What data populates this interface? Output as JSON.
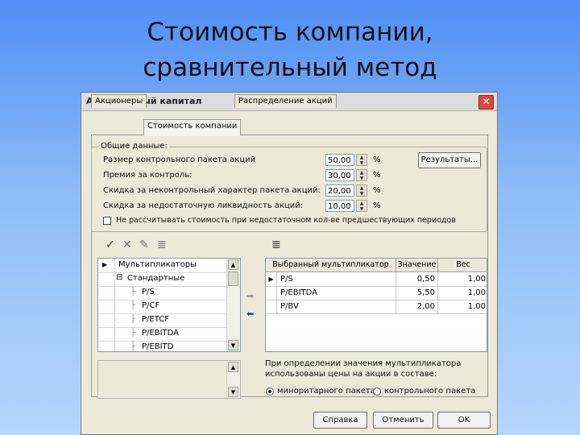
{
  "slide": {
    "title_line1": "Стоимость компании,",
    "title_line2": "сравнительный метод"
  },
  "window": {
    "title": "Акционерный капитал",
    "close_glyph": "✕"
  },
  "tabs": [
    {
      "label": "Акционеры"
    },
    {
      "label": "Стоимость компании"
    },
    {
      "label": "Распределение акций"
    }
  ],
  "general": {
    "group_label": "Общие данные:",
    "rows": [
      {
        "label": "Размер контрольного пакета акций",
        "value": "50,00",
        "unit": "%"
      },
      {
        "label": "Премия за контроль:",
        "value": "30,00",
        "unit": "%"
      },
      {
        "label": "Скидка за неконтрольный характер пакета акций:",
        "value": "20,00",
        "unit": "%"
      },
      {
        "label": "Скидка за недостаточную ликвидность акций:",
        "value": "10,00",
        "unit": "%"
      }
    ],
    "results_button": "Результаты...",
    "checkbox_label": "Не рассчитывать стоимость при недостаточном кол-ве предшествующих периодов"
  },
  "tree": {
    "rows": [
      {
        "label": "Мультипликаторы",
        "marker": "▶"
      },
      {
        "label": "Стандартные",
        "marker": ""
      },
      {
        "label": "P/S",
        "marker": ""
      },
      {
        "label": "P/CF",
        "marker": ""
      },
      {
        "label": "P/ETCF",
        "marker": ""
      },
      {
        "label": "P/EBITDA",
        "marker": ""
      },
      {
        "label": "P/EBITD",
        "marker": ""
      }
    ],
    "expand_glyph": "⊟"
  },
  "grid": {
    "headers": [
      "Выбранный мультипликатор",
      "Значение",
      "Вес"
    ],
    "rows": [
      {
        "name": "P/S",
        "value": "0,50",
        "weight": "1,00",
        "marker": "▶"
      },
      {
        "name": "P/EBITDA",
        "value": "5,50",
        "weight": "1,00",
        "marker": ""
      },
      {
        "name": "P/BV",
        "value": "2,00",
        "weight": "1,00",
        "marker": ""
      }
    ]
  },
  "note": {
    "text": "При определении значения мультипликатора использованы цены на акции в составе:",
    "radio_minority": "миноритарного пакета",
    "radio_control": "контрольного пакета"
  },
  "buttons": {
    "help": "Справка",
    "cancel": "Отменить",
    "ok": "OK"
  },
  "colors": {
    "accent_arrow": "#1a3fcf",
    "arrow_gray": "#9a9a9a"
  }
}
